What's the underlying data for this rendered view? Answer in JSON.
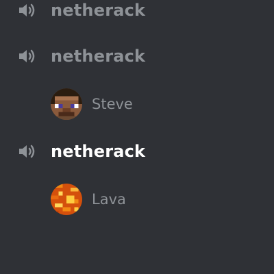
{
  "voice_channels": [
    {
      "name": "netherack",
      "icon": "speaker-icon"
    },
    {
      "name": "netherack",
      "icon": "speaker-icon",
      "members": [
        {
          "name": "Steve",
          "avatar": "steve-avatar"
        }
      ]
    },
    {
      "name": "netherack",
      "icon": "speaker-icon",
      "members": [
        {
          "name": "Lava",
          "avatar": "lava-avatar"
        }
      ]
    }
  ],
  "colors": {
    "background": "#2f3136",
    "channel_text": "#8e9297",
    "channel_active_text": "#ffffff",
    "icon": "#8e9297"
  }
}
